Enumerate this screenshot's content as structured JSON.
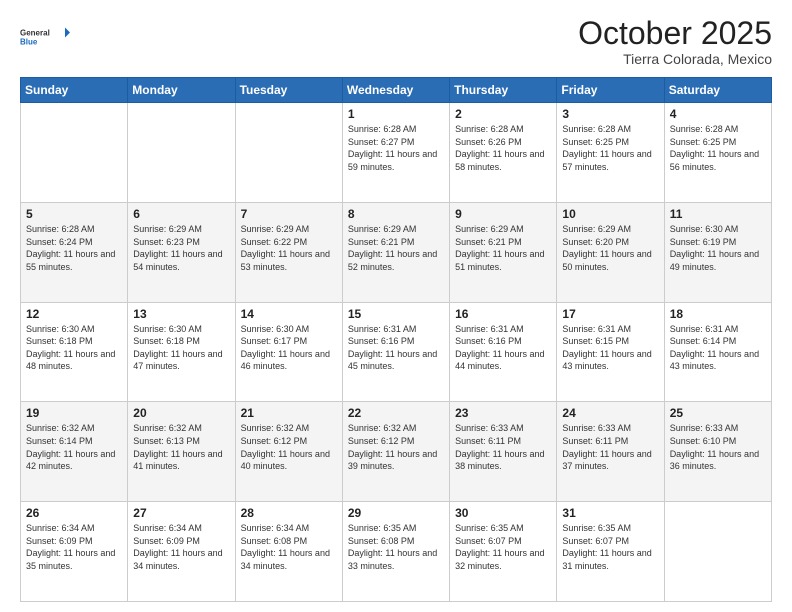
{
  "header": {
    "logo_general": "General",
    "logo_blue": "Blue",
    "month_title": "October 2025",
    "subtitle": "Tierra Colorada, Mexico"
  },
  "days_of_week": [
    "Sunday",
    "Monday",
    "Tuesday",
    "Wednesday",
    "Thursday",
    "Friday",
    "Saturday"
  ],
  "weeks": [
    [
      {
        "day": "",
        "sunrise": "",
        "sunset": "",
        "daylight": ""
      },
      {
        "day": "",
        "sunrise": "",
        "sunset": "",
        "daylight": ""
      },
      {
        "day": "",
        "sunrise": "",
        "sunset": "",
        "daylight": ""
      },
      {
        "day": "1",
        "sunrise": "Sunrise: 6:28 AM",
        "sunset": "Sunset: 6:27 PM",
        "daylight": "Daylight: 11 hours and 59 minutes."
      },
      {
        "day": "2",
        "sunrise": "Sunrise: 6:28 AM",
        "sunset": "Sunset: 6:26 PM",
        "daylight": "Daylight: 11 hours and 58 minutes."
      },
      {
        "day": "3",
        "sunrise": "Sunrise: 6:28 AM",
        "sunset": "Sunset: 6:25 PM",
        "daylight": "Daylight: 11 hours and 57 minutes."
      },
      {
        "day": "4",
        "sunrise": "Sunrise: 6:28 AM",
        "sunset": "Sunset: 6:25 PM",
        "daylight": "Daylight: 11 hours and 56 minutes."
      }
    ],
    [
      {
        "day": "5",
        "sunrise": "Sunrise: 6:28 AM",
        "sunset": "Sunset: 6:24 PM",
        "daylight": "Daylight: 11 hours and 55 minutes."
      },
      {
        "day": "6",
        "sunrise": "Sunrise: 6:29 AM",
        "sunset": "Sunset: 6:23 PM",
        "daylight": "Daylight: 11 hours and 54 minutes."
      },
      {
        "day": "7",
        "sunrise": "Sunrise: 6:29 AM",
        "sunset": "Sunset: 6:22 PM",
        "daylight": "Daylight: 11 hours and 53 minutes."
      },
      {
        "day": "8",
        "sunrise": "Sunrise: 6:29 AM",
        "sunset": "Sunset: 6:21 PM",
        "daylight": "Daylight: 11 hours and 52 minutes."
      },
      {
        "day": "9",
        "sunrise": "Sunrise: 6:29 AM",
        "sunset": "Sunset: 6:21 PM",
        "daylight": "Daylight: 11 hours and 51 minutes."
      },
      {
        "day": "10",
        "sunrise": "Sunrise: 6:29 AM",
        "sunset": "Sunset: 6:20 PM",
        "daylight": "Daylight: 11 hours and 50 minutes."
      },
      {
        "day": "11",
        "sunrise": "Sunrise: 6:30 AM",
        "sunset": "Sunset: 6:19 PM",
        "daylight": "Daylight: 11 hours and 49 minutes."
      }
    ],
    [
      {
        "day": "12",
        "sunrise": "Sunrise: 6:30 AM",
        "sunset": "Sunset: 6:18 PM",
        "daylight": "Daylight: 11 hours and 48 minutes."
      },
      {
        "day": "13",
        "sunrise": "Sunrise: 6:30 AM",
        "sunset": "Sunset: 6:18 PM",
        "daylight": "Daylight: 11 hours and 47 minutes."
      },
      {
        "day": "14",
        "sunrise": "Sunrise: 6:30 AM",
        "sunset": "Sunset: 6:17 PM",
        "daylight": "Daylight: 11 hours and 46 minutes."
      },
      {
        "day": "15",
        "sunrise": "Sunrise: 6:31 AM",
        "sunset": "Sunset: 6:16 PM",
        "daylight": "Daylight: 11 hours and 45 minutes."
      },
      {
        "day": "16",
        "sunrise": "Sunrise: 6:31 AM",
        "sunset": "Sunset: 6:16 PM",
        "daylight": "Daylight: 11 hours and 44 minutes."
      },
      {
        "day": "17",
        "sunrise": "Sunrise: 6:31 AM",
        "sunset": "Sunset: 6:15 PM",
        "daylight": "Daylight: 11 hours and 43 minutes."
      },
      {
        "day": "18",
        "sunrise": "Sunrise: 6:31 AM",
        "sunset": "Sunset: 6:14 PM",
        "daylight": "Daylight: 11 hours and 43 minutes."
      }
    ],
    [
      {
        "day": "19",
        "sunrise": "Sunrise: 6:32 AM",
        "sunset": "Sunset: 6:14 PM",
        "daylight": "Daylight: 11 hours and 42 minutes."
      },
      {
        "day": "20",
        "sunrise": "Sunrise: 6:32 AM",
        "sunset": "Sunset: 6:13 PM",
        "daylight": "Daylight: 11 hours and 41 minutes."
      },
      {
        "day": "21",
        "sunrise": "Sunrise: 6:32 AM",
        "sunset": "Sunset: 6:12 PM",
        "daylight": "Daylight: 11 hours and 40 minutes."
      },
      {
        "day": "22",
        "sunrise": "Sunrise: 6:32 AM",
        "sunset": "Sunset: 6:12 PM",
        "daylight": "Daylight: 11 hours and 39 minutes."
      },
      {
        "day": "23",
        "sunrise": "Sunrise: 6:33 AM",
        "sunset": "Sunset: 6:11 PM",
        "daylight": "Daylight: 11 hours and 38 minutes."
      },
      {
        "day": "24",
        "sunrise": "Sunrise: 6:33 AM",
        "sunset": "Sunset: 6:11 PM",
        "daylight": "Daylight: 11 hours and 37 minutes."
      },
      {
        "day": "25",
        "sunrise": "Sunrise: 6:33 AM",
        "sunset": "Sunset: 6:10 PM",
        "daylight": "Daylight: 11 hours and 36 minutes."
      }
    ],
    [
      {
        "day": "26",
        "sunrise": "Sunrise: 6:34 AM",
        "sunset": "Sunset: 6:09 PM",
        "daylight": "Daylight: 11 hours and 35 minutes."
      },
      {
        "day": "27",
        "sunrise": "Sunrise: 6:34 AM",
        "sunset": "Sunset: 6:09 PM",
        "daylight": "Daylight: 11 hours and 34 minutes."
      },
      {
        "day": "28",
        "sunrise": "Sunrise: 6:34 AM",
        "sunset": "Sunset: 6:08 PM",
        "daylight": "Daylight: 11 hours and 34 minutes."
      },
      {
        "day": "29",
        "sunrise": "Sunrise: 6:35 AM",
        "sunset": "Sunset: 6:08 PM",
        "daylight": "Daylight: 11 hours and 33 minutes."
      },
      {
        "day": "30",
        "sunrise": "Sunrise: 6:35 AM",
        "sunset": "Sunset: 6:07 PM",
        "daylight": "Daylight: 11 hours and 32 minutes."
      },
      {
        "day": "31",
        "sunrise": "Sunrise: 6:35 AM",
        "sunset": "Sunset: 6:07 PM",
        "daylight": "Daylight: 11 hours and 31 minutes."
      },
      {
        "day": "",
        "sunrise": "",
        "sunset": "",
        "daylight": ""
      }
    ]
  ]
}
